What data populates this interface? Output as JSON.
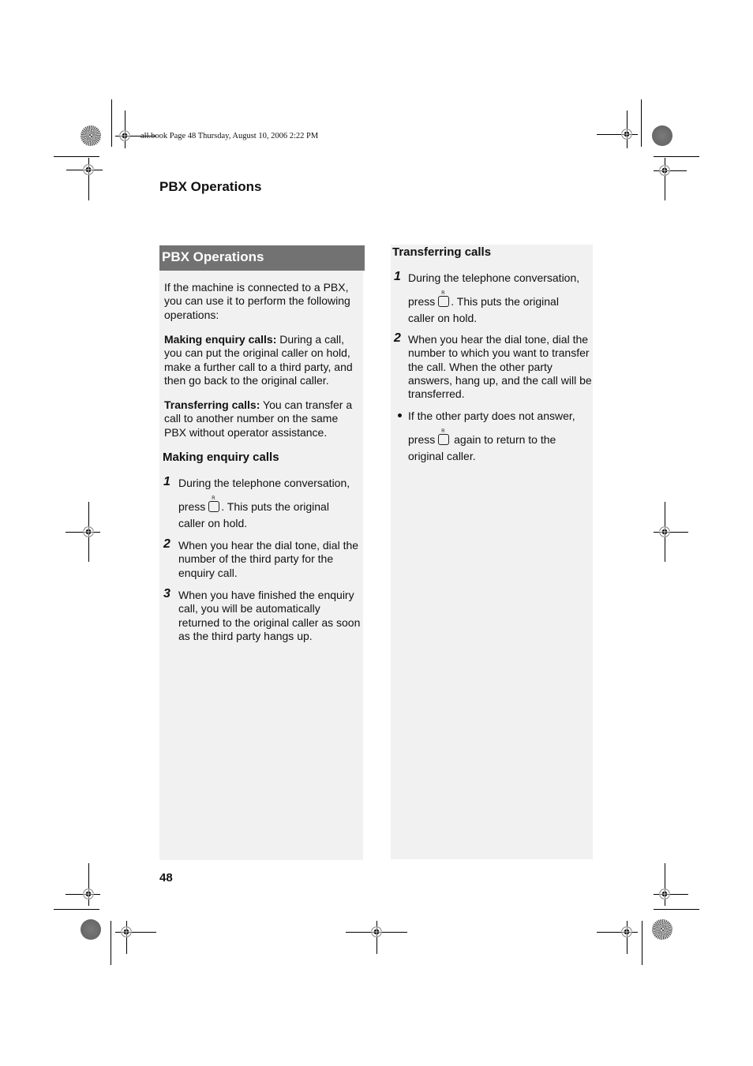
{
  "slug": "all.book  Page 48  Thursday, August 10, 2006  2:22 PM",
  "running_head": "PBX Operations",
  "page_number": "48",
  "left_column": {
    "section_title": "PBX Operations",
    "intro": "If the machine is connected to a PBX, you can use it to perform the following operations:",
    "def1_term": "Making enquiry calls:",
    "def1_text": " During a call, you can put the original caller on hold, make a further call to a third party, and then go back to the original caller.",
    "def2_term": "Transferring calls:",
    "def2_text": " You can transfer a call to another number on the same PBX without operator assistance.",
    "subheading": "Making enquiry calls",
    "steps": [
      {
        "num": "1",
        "line1": "During the telephone conversation,",
        "pre": "press",
        "post": ". This puts the original",
        "line3": "caller on hold."
      },
      {
        "num": "2",
        "text": "When you hear the dial tone, dial the number of the third party for the enquiry call."
      },
      {
        "num": "3",
        "text": "When you have finished the enquiry call, you will be automatically returned to the original caller as soon as the third party hangs up."
      }
    ]
  },
  "right_column": {
    "subheading": "Transferring calls",
    "steps": [
      {
        "num": "1",
        "line1": "During the telephone conversation,",
        "pre": "press",
        "post": ". This puts the original",
        "line3": "caller on hold."
      },
      {
        "num": "2",
        "text": "When you hear the dial tone, dial the number to which you want to transfer the call. When the other party answers, hang up, and the call will be transferred."
      }
    ],
    "note": {
      "line1": "If the other party does not answer,",
      "pre": "press",
      "post": " again to return to the",
      "line3": "original caller."
    }
  },
  "icons": {
    "key": "r-key-icon",
    "registration": "registration-mark-icon",
    "color_bar": "color-target-icon"
  }
}
